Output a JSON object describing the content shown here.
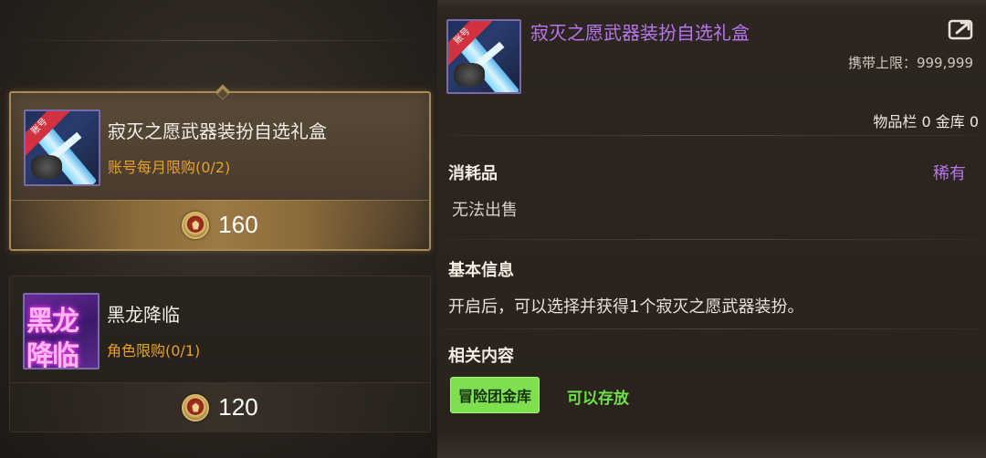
{
  "shop": {
    "items": [
      {
        "name": "寂灭之愿武器装扮自选礼盒",
        "limit": "账号每月限购(0/2)",
        "price": "160",
        "selected": true,
        "icon": "weapon-giftbox-icon",
        "ribbon": "账号"
      },
      {
        "name": "黑龙降临",
        "limit": "角色限购(0/1)",
        "price": "120",
        "selected": false,
        "icon": "black-dragon-icon",
        "art_text": [
          "黑龙",
          "降临"
        ]
      }
    ]
  },
  "detail": {
    "title": "寂灭之愿武器装扮自选礼盒",
    "carry_limit": "携带上限：999,999",
    "storage": "物品栏 0 金库 0",
    "category": "消耗品",
    "rarity": "稀有",
    "sell_status": "无法出售",
    "basic_info_heading": "基本信息",
    "basic_info_text": "开启后，可以选择并获得1个寂灭之愿武器装扮。",
    "related_heading": "相关内容",
    "related_tag": "冒险团金库",
    "related_tag_note": "可以存放"
  },
  "colors": {
    "rarity_purple": "#b676f0",
    "limit_orange": "#e8a02a",
    "tag_green": "#7ee04e",
    "selected_border": "#a98c55"
  }
}
